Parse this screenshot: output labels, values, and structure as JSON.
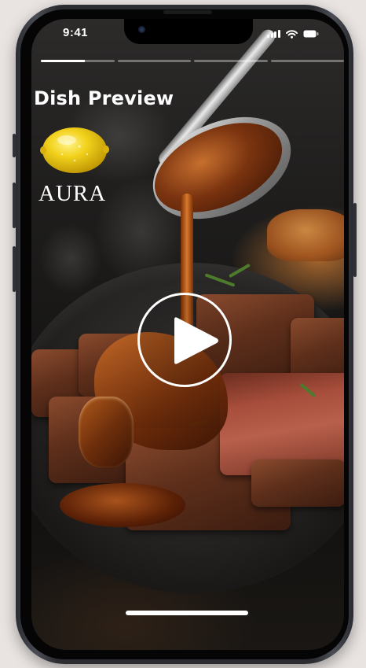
{
  "status_bar": {
    "time": "9:41",
    "icons": [
      "signal-icon",
      "wifi-icon",
      "battery-icon"
    ]
  },
  "story_progress": {
    "segments": 4,
    "active_index": 0,
    "active_fill": 0.6
  },
  "header": {
    "title": "Dish Preview",
    "logo_icon": "lemon-icon",
    "brand": "AURA"
  },
  "video": {
    "subject_icon": "steak-with-sauce-image",
    "play_icon": "play-icon"
  },
  "colors": {
    "accent": "#ffffff",
    "lemon": "#f2d21c",
    "sauce": "#a8521c"
  }
}
